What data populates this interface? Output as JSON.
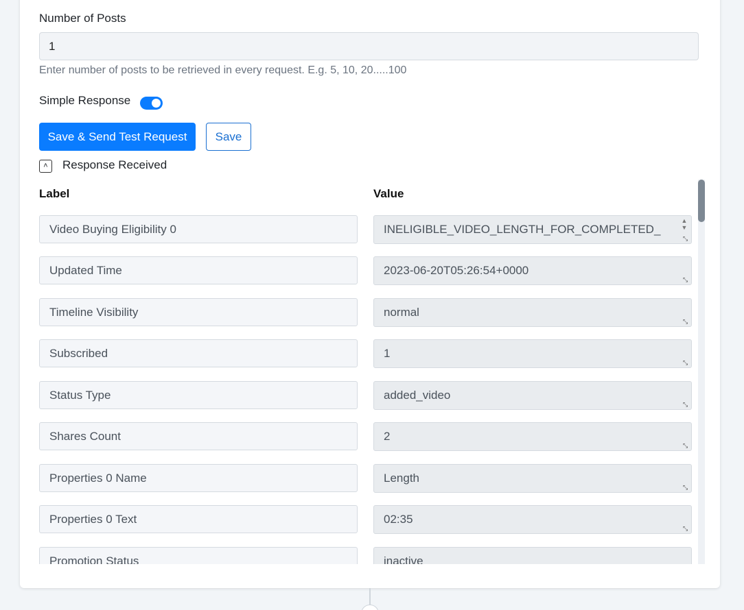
{
  "form": {
    "number_of_posts_label": "Number of Posts",
    "number_of_posts_value": "1",
    "number_of_posts_hint": "Enter number of posts to be retrieved in every request. E.g. 5, 10, 20.....100",
    "simple_response_label": "Simple Response",
    "simple_response_enabled": true,
    "save_send_label": "Save & Send Test Request",
    "save_label": "Save"
  },
  "response": {
    "title": "Response Received",
    "label_header": "Label",
    "value_header": "Value",
    "rows": [
      {
        "label": "Video Buying Eligibility 0",
        "value": "INELIGIBLE_VIDEO_LENGTH_FOR_COMPLETED_"
      },
      {
        "label": "Updated Time",
        "value": "2023-06-20T05:26:54+0000"
      },
      {
        "label": "Timeline Visibility",
        "value": "normal"
      },
      {
        "label": "Subscribed",
        "value": "1"
      },
      {
        "label": "Status Type",
        "value": "added_video"
      },
      {
        "label": "Shares Count",
        "value": "2"
      },
      {
        "label": "Properties 0 Name",
        "value": "Length"
      },
      {
        "label": "Properties 0 Text",
        "value": "02:35"
      },
      {
        "label": "Promotion Status",
        "value": "inactive"
      }
    ]
  },
  "colors": {
    "primary": "#0a7cff",
    "background": "#f2f5f8"
  }
}
